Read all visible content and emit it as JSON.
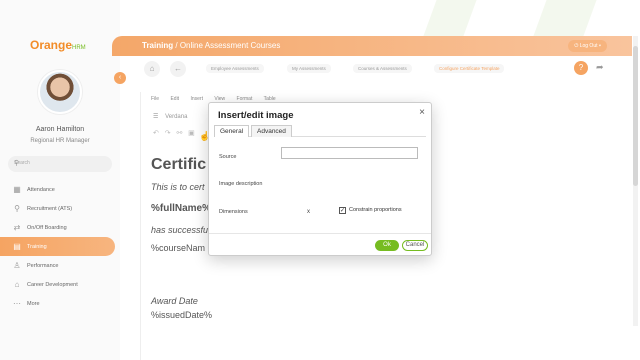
{
  "sidebar": {
    "logo_orange": "Orange",
    "logo_hrm": "HRM",
    "user_name": "Aaron Hamilton",
    "user_role": "Regional HR Manager",
    "search_placeholder": "Search",
    "items": [
      {
        "label": "Attendance",
        "icon": "calendar-icon"
      },
      {
        "label": "Recruitment (ATS)",
        "icon": "search-person-icon"
      },
      {
        "label": "On/Off Boarding",
        "icon": "boarding-icon"
      },
      {
        "label": "Training",
        "icon": "training-icon",
        "active": true
      },
      {
        "label": "Performance",
        "icon": "performance-icon"
      },
      {
        "label": "Career Development",
        "icon": "career-icon"
      },
      {
        "label": "More",
        "icon": "more-icon"
      }
    ]
  },
  "header": {
    "section": "Training",
    "separator": "/",
    "page": "Online Assessment Courses",
    "logout": "Log Out"
  },
  "nav_tabs": [
    "Employee Assessments",
    "My Assessments",
    "Courses & Assessments",
    "Configure Certificate Template"
  ],
  "editor": {
    "menu": [
      "File",
      "Edit",
      "Insert",
      "View",
      "Format",
      "Table"
    ],
    "font": "Verdana",
    "content": {
      "heading": "Certific",
      "line1": "This is to cert",
      "line2": "%fullName%",
      "line3": "has successfu",
      "line4": "%courseNam",
      "line5": "Award Date",
      "line6": "%issuedDate%"
    }
  },
  "dialog": {
    "title": "Insert/edit image",
    "close": "×",
    "tabs": [
      "General",
      "Advanced"
    ],
    "source_label": "Source",
    "description_label": "Image description",
    "dimensions_label": "Dimensions",
    "dim_x": "x",
    "constrain_label": "Constrain proportions",
    "constrain_checked": true,
    "ok": "Ok",
    "cancel": "Cancel"
  },
  "colors": {
    "accent_orange": "#f5a462",
    "accent_green": "#76bc21"
  }
}
